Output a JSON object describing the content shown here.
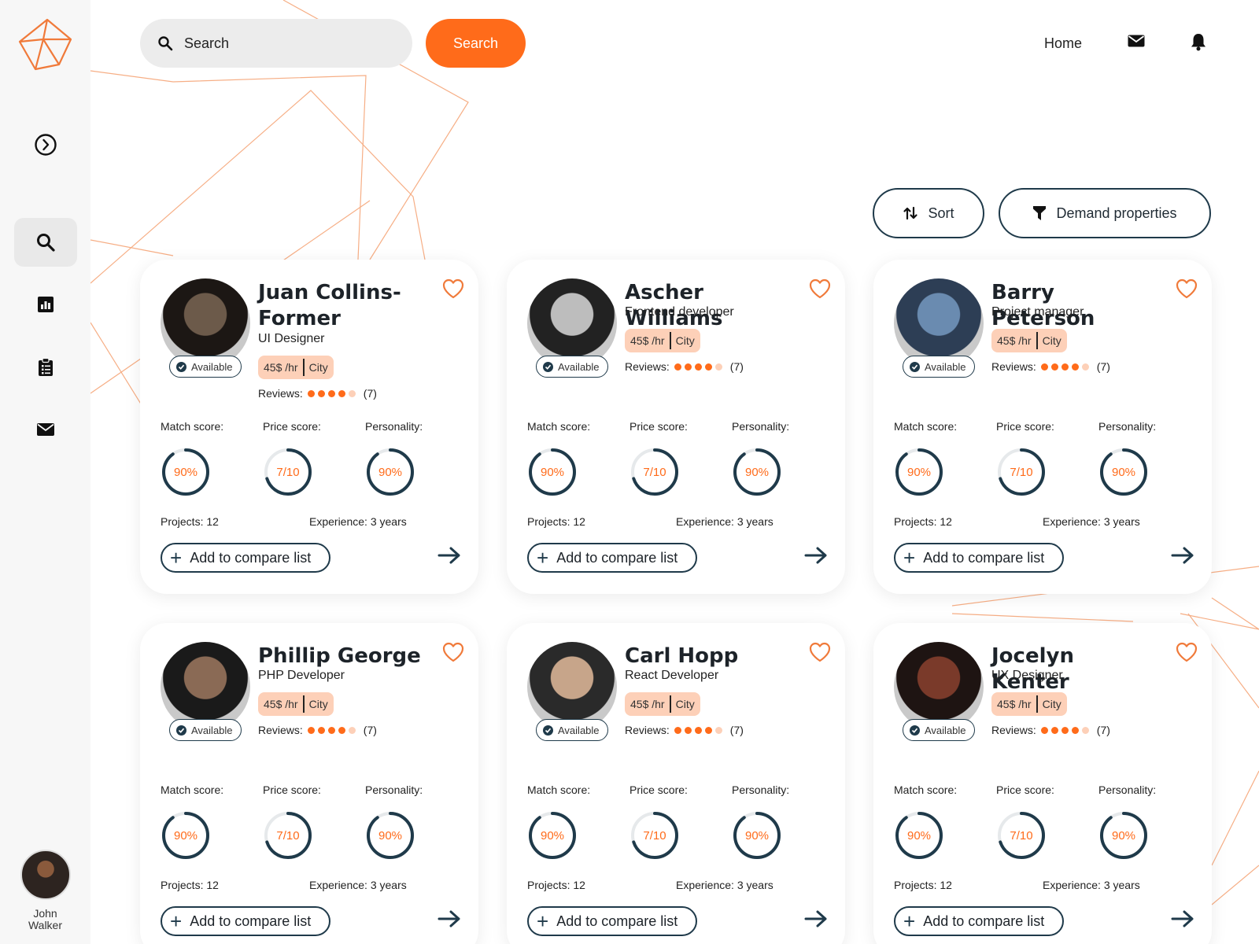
{
  "search": {
    "placeholder": "Search",
    "button_label": "Search"
  },
  "nav": {
    "home": "Home"
  },
  "sidebar": {
    "items": [
      {
        "icon": "chevron-right-circle-icon"
      },
      {
        "icon": "search-icon",
        "active": true
      },
      {
        "icon": "bar-chart-icon"
      },
      {
        "icon": "clipboard-list-icon"
      },
      {
        "icon": "mail-icon"
      }
    ],
    "user": {
      "name": "John Walker"
    }
  },
  "toolbar": {
    "sort_label": "Sort",
    "demand_label": "Demand properties"
  },
  "labels": {
    "available": "Available",
    "reviews": "Reviews:",
    "match_score": "Match score:",
    "price_score": "Price score:",
    "personality": "Personality:",
    "projects": "Projects:",
    "experience": "Experience:",
    "compare": "Add to compare list",
    "per_hour": "45$ /hr",
    "city": "City"
  },
  "colors": {
    "accent": "#ff6b1a",
    "accent_light": "#fdd0b8",
    "dark": "#1f3a4a"
  },
  "candidates": [
    {
      "name": "Juan Collins-Former",
      "role": "UI Designer",
      "rating": 4,
      "reviews_count": "(7)",
      "match": "90%",
      "match_value": 0.9,
      "price": "7/10",
      "price_value": 0.7,
      "personality": "90%",
      "personality_value": 0.9,
      "projects": "12",
      "experience": "3 years"
    },
    {
      "name": "Ascher Williams",
      "role": "Frontend developer",
      "rating": 4,
      "reviews_count": "(7)",
      "match": "90%",
      "match_value": 0.9,
      "price": "7/10",
      "price_value": 0.7,
      "personality": "90%",
      "personality_value": 0.9,
      "projects": "12",
      "experience": "3 years"
    },
    {
      "name": "Barry Peterson",
      "role": "Project manager",
      "rating": 4,
      "reviews_count": "(7)",
      "match": "90%",
      "match_value": 0.9,
      "price": "7/10",
      "price_value": 0.7,
      "personality": "90%",
      "personality_value": 0.9,
      "projects": "12",
      "experience": "3 years"
    },
    {
      "name": "Phillip George",
      "role": "PHP Developer",
      "rating": 4,
      "reviews_count": "(7)",
      "match": "90%",
      "match_value": 0.9,
      "price": "7/10",
      "price_value": 0.7,
      "personality": "90%",
      "personality_value": 0.9,
      "projects": "12",
      "experience": "3 years"
    },
    {
      "name": "Carl Hopp",
      "role": "React Developer",
      "rating": 4,
      "reviews_count": "(7)",
      "match": "90%",
      "match_value": 0.9,
      "price": "7/10",
      "price_value": 0.7,
      "personality": "90%",
      "personality_value": 0.9,
      "projects": "12",
      "experience": "3 years"
    },
    {
      "name": "Jocelyn Kenter",
      "role": "UX Designer",
      "rating": 4,
      "reviews_count": "(7)",
      "match": "90%",
      "match_value": 0.9,
      "price": "7/10",
      "price_value": 0.7,
      "personality": "90%",
      "personality_value": 0.9,
      "projects": "12",
      "experience": "3 years"
    }
  ]
}
